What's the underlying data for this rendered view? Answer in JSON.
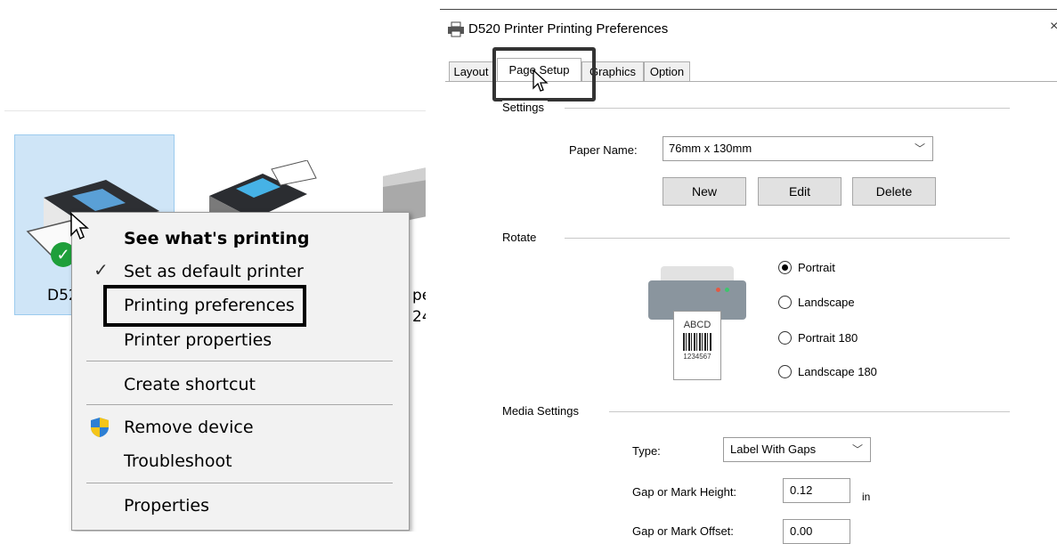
{
  "left": {
    "printer_label_partial": "D52",
    "fax_label_partial": "pe",
    "fax_label_partial2": "24",
    "context_menu": {
      "items": [
        "See what's printing",
        "Set as default printer",
        "Printing preferences",
        "Printer properties",
        "Create shortcut",
        "Remove device",
        "Troubleshoot",
        "Properties"
      ]
    }
  },
  "dialog": {
    "title": "D520 Printer Printing Preferences",
    "close_glyph": "×",
    "tabs": [
      "Layout",
      "Page Setup",
      "Graphics",
      "Option"
    ],
    "settings": {
      "group": "Settings",
      "paper_name_label": "Paper Name:",
      "paper_name_value": "76mm x 130mm",
      "buttons": [
        "New",
        "Edit",
        "Delete"
      ]
    },
    "rotate": {
      "group": "Rotate",
      "options": [
        "Portrait",
        "Landscape",
        "Portrait 180",
        "Landscape 180"
      ],
      "selected": "Portrait",
      "preview_text": "ABCD",
      "preview_number": "1234567"
    },
    "media": {
      "group": "Media Settings",
      "type_label": "Type:",
      "type_value": "Label With Gaps",
      "gap_height_label": "Gap or Mark Height:",
      "gap_height_value": "0.12",
      "gap_height_unit": "in",
      "gap_offset_label": "Gap or Mark Offset:",
      "gap_offset_value": "0.00"
    }
  },
  "colors": {
    "tile_bg": "#cfe5f7",
    "menu_bg": "#f2f2f2",
    "status_green": "#1e9f3a",
    "shield_blue": "#2d7fd3",
    "shield_yellow": "#f5c518"
  }
}
